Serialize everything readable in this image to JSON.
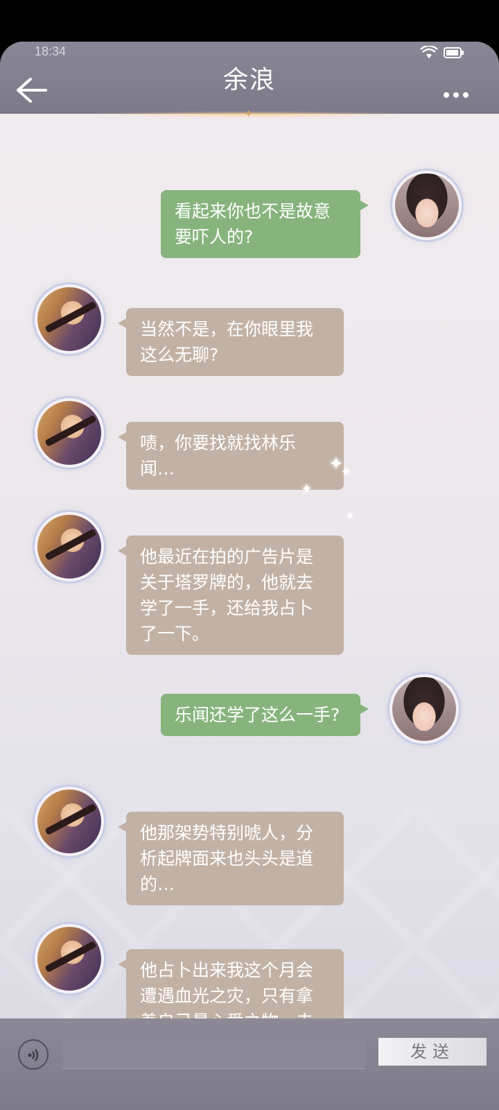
{
  "status_bar": {
    "time": "18:34"
  },
  "header": {
    "title": "余浪"
  },
  "messages": [
    {
      "side": "right",
      "text": "看起来你也不是故意要吓人的?"
    },
    {
      "side": "left",
      "text": "当然不是，在你眼里我这么无聊?"
    },
    {
      "side": "left",
      "text": "啧，你要找就找林乐闻…"
    },
    {
      "side": "left",
      "text": "他最近在拍的广告片是关于塔罗牌的，他就去学了一手，还给我占卜了一下。"
    },
    {
      "side": "right",
      "text": "乐闻还学了这么一手?"
    },
    {
      "side": "left",
      "text": "他那架势特别唬人，分析起牌面来也头头是道的…"
    },
    {
      "side": "left",
      "text": "他占卜出来我这个月会遭遇血光之灾，只有拿着自己最心爱之物，去平时最常去的集体场所"
    }
  ],
  "input": {
    "send_label": "发送"
  },
  "colors": {
    "bubble_self": "#87b47d",
    "bubble_other": "#c2b2a6",
    "header": "#85818f"
  }
}
